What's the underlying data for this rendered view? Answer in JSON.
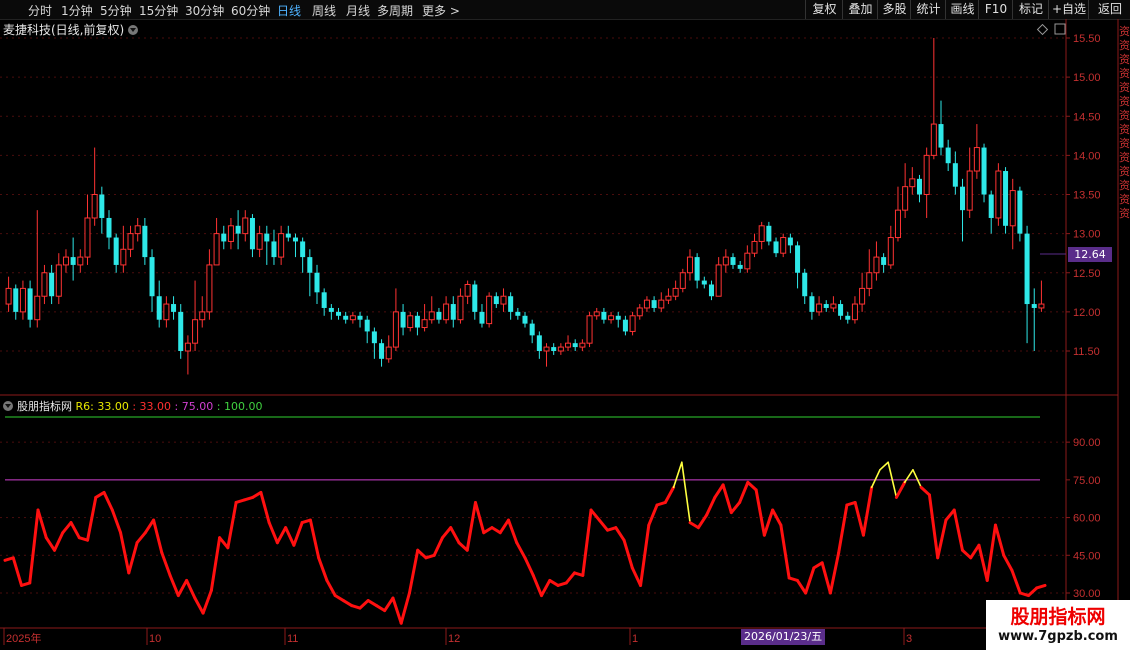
{
  "toolbar": {
    "timeframes": [
      "分时",
      "1分钟",
      "5分钟",
      "15分钟",
      "30分钟",
      "60分钟",
      "日线",
      "周线",
      "月线",
      "多周期",
      "更多 >"
    ],
    "active": "日线",
    "right_buttons": [
      "复权",
      "叠加",
      "多股",
      "统计",
      "画线",
      "F10",
      "标记",
      "+自选",
      "返回"
    ]
  },
  "chart": {
    "title": "麦捷科技(日线,前复权)",
    "price_axis": [
      "15.50",
      "15.00",
      "14.50",
      "14.00",
      "13.50",
      "13.00",
      "12.50",
      "12.00",
      "11.50"
    ],
    "current_price": "12.64",
    "indicator_label": "股朋指标网",
    "indicator_values": [
      {
        "text": "R6: 33.00",
        "color": "#e8e800"
      },
      {
        "text": " : 33.00",
        "color": "#ff3030"
      },
      {
        "text": " : 75.00",
        "color": "#d040d0"
      },
      {
        "text": " : 100.00",
        "color": "#40d040"
      }
    ],
    "indicator_axis": [
      "90.00",
      "75.00",
      "60.00",
      "45.00",
      "30.00"
    ],
    "x_labels": [
      "2025年",
      "10",
      "11",
      "12",
      "1",
      "3"
    ],
    "date_badge": "2026/01/23/五",
    "colors": {
      "up": "#ff3333",
      "down": "#2ee8e8",
      "r6": "#ff1010",
      "r6_over": "#ffff40",
      "level75": "#d040d0",
      "level100": "#30d030"
    }
  },
  "chart_data": [
    {
      "type": "candlestick",
      "ylim": [
        11.0,
        15.6
      ],
      "candles": [
        [
          12.1,
          12.3,
          12.45,
          12.0
        ],
        [
          12.3,
          12.0,
          12.35,
          11.9
        ],
        [
          12.0,
          12.3,
          12.4,
          11.9
        ],
        [
          12.3,
          11.9,
          12.4,
          11.8
        ],
        [
          11.9,
          12.2,
          13.3,
          11.8
        ],
        [
          12.2,
          12.5,
          12.6,
          12.1
        ],
        [
          12.5,
          12.2,
          12.6,
          12.1
        ],
        [
          12.2,
          12.6,
          12.75,
          12.1
        ],
        [
          12.6,
          12.7,
          12.8,
          12.5
        ],
        [
          12.7,
          12.6,
          12.95,
          12.4
        ],
        [
          12.6,
          12.7,
          12.8,
          12.5
        ],
        [
          12.7,
          13.2,
          13.5,
          12.6
        ],
        [
          13.2,
          13.5,
          14.1,
          13.1
        ],
        [
          13.5,
          13.2,
          13.6,
          13.0
        ],
        [
          13.2,
          12.95,
          13.3,
          12.8
        ],
        [
          12.95,
          12.6,
          13.0,
          12.5
        ],
        [
          12.6,
          12.8,
          13.1,
          12.5
        ],
        [
          12.8,
          13.0,
          13.1,
          12.7
        ],
        [
          13.0,
          13.1,
          13.2,
          12.9
        ],
        [
          13.1,
          12.7,
          13.2,
          12.6
        ],
        [
          12.7,
          12.2,
          12.8,
          12.0
        ],
        [
          12.2,
          11.9,
          12.4,
          11.8
        ],
        [
          11.9,
          12.1,
          12.2,
          11.8
        ],
        [
          12.1,
          12.0,
          12.2,
          11.9
        ],
        [
          12.0,
          11.5,
          12.1,
          11.4
        ],
        [
          11.5,
          11.6,
          11.7,
          11.2
        ],
        [
          11.6,
          11.9,
          12.4,
          11.5
        ],
        [
          11.9,
          12.0,
          12.2,
          11.8
        ],
        [
          12.0,
          12.6,
          12.8,
          11.9
        ],
        [
          12.6,
          13.0,
          13.2,
          12.6
        ],
        [
          13.0,
          12.9,
          13.1,
          12.8
        ],
        [
          12.9,
          13.1,
          13.2,
          12.8
        ],
        [
          13.1,
          13.0,
          13.3,
          12.8
        ],
        [
          13.0,
          13.2,
          13.3,
          12.9
        ],
        [
          13.2,
          12.8,
          13.25,
          12.7
        ],
        [
          12.8,
          13.0,
          13.1,
          12.7
        ],
        [
          13.0,
          12.9,
          13.1,
          12.6
        ],
        [
          12.9,
          12.7,
          13.05,
          12.6
        ],
        [
          12.7,
          13.0,
          13.1,
          12.6
        ],
        [
          13.0,
          12.95,
          13.1,
          12.9
        ],
        [
          12.95,
          12.9,
          13.0,
          12.7
        ],
        [
          12.9,
          12.7,
          12.95,
          12.5
        ],
        [
          12.7,
          12.5,
          12.8,
          12.2
        ],
        [
          12.5,
          12.25,
          12.6,
          12.1
        ],
        [
          12.25,
          12.05,
          12.3,
          11.95
        ],
        [
          12.05,
          12.0,
          12.1,
          11.9
        ],
        [
          12.0,
          11.95,
          12.05,
          11.9
        ],
        [
          11.95,
          11.9,
          12.0,
          11.85
        ],
        [
          11.9,
          11.95,
          12.0,
          11.85
        ],
        [
          11.95,
          11.9,
          12.0,
          11.8
        ],
        [
          11.9,
          11.75,
          11.95,
          11.6
        ],
        [
          11.75,
          11.6,
          11.8,
          11.4
        ],
        [
          11.6,
          11.4,
          11.65,
          11.3
        ],
        [
          11.4,
          11.55,
          11.7,
          11.35
        ],
        [
          11.55,
          12.0,
          12.3,
          11.5
        ],
        [
          12.0,
          11.8,
          12.1,
          11.7
        ],
        [
          11.8,
          11.95,
          12.0,
          11.75
        ],
        [
          11.95,
          11.8,
          12.0,
          11.7
        ],
        [
          11.8,
          11.9,
          12.1,
          11.75
        ],
        [
          11.9,
          12.0,
          12.2,
          11.85
        ],
        [
          12.0,
          11.9,
          12.05,
          11.85
        ],
        [
          11.9,
          12.1,
          12.2,
          11.85
        ],
        [
          12.1,
          11.9,
          12.2,
          11.8
        ],
        [
          11.9,
          12.2,
          12.3,
          11.85
        ],
        [
          12.2,
          12.35,
          12.4,
          12.1
        ],
        [
          12.35,
          12.0,
          12.4,
          11.9
        ],
        [
          12.0,
          11.85,
          12.1,
          11.8
        ],
        [
          11.85,
          12.2,
          12.25,
          11.8
        ],
        [
          12.2,
          12.1,
          12.25,
          12.05
        ],
        [
          12.1,
          12.2,
          12.3,
          12.0
        ],
        [
          12.2,
          12.0,
          12.25,
          11.9
        ],
        [
          12.0,
          11.95,
          12.05,
          11.9
        ],
        [
          11.95,
          11.85,
          12.0,
          11.8
        ],
        [
          11.85,
          11.7,
          11.9,
          11.6
        ],
        [
          11.7,
          11.5,
          11.75,
          11.4
        ],
        [
          11.5,
          11.55,
          11.6,
          11.3
        ],
        [
          11.55,
          11.5,
          11.6,
          11.45
        ],
        [
          11.5,
          11.55,
          11.6,
          11.45
        ],
        [
          11.55,
          11.6,
          11.7,
          11.5
        ],
        [
          11.6,
          11.55,
          11.65,
          11.5
        ],
        [
          11.55,
          11.6,
          11.65,
          11.5
        ],
        [
          11.6,
          11.95,
          12.0,
          11.55
        ],
        [
          11.95,
          12.0,
          12.05,
          11.9
        ],
        [
          12.0,
          11.9,
          12.05,
          11.85
        ],
        [
          11.9,
          11.95,
          12.0,
          11.85
        ],
        [
          11.95,
          11.9,
          12.0,
          11.8
        ],
        [
          11.9,
          11.75,
          11.95,
          11.7
        ],
        [
          11.75,
          11.95,
          12.0,
          11.7
        ],
        [
          11.95,
          12.05,
          12.1,
          11.9
        ],
        [
          12.05,
          12.15,
          12.2,
          12.0
        ],
        [
          12.15,
          12.05,
          12.2,
          12.0
        ],
        [
          12.05,
          12.15,
          12.25,
          12.0
        ],
        [
          12.15,
          12.2,
          12.3,
          12.1
        ],
        [
          12.2,
          12.3,
          12.4,
          12.15
        ],
        [
          12.3,
          12.5,
          12.55,
          12.25
        ],
        [
          12.5,
          12.7,
          12.8,
          12.4
        ],
        [
          12.7,
          12.4,
          12.75,
          12.3
        ],
        [
          12.4,
          12.35,
          12.45,
          12.3
        ],
        [
          12.35,
          12.2,
          12.4,
          12.15
        ],
        [
          12.2,
          12.6,
          12.7,
          12.2
        ],
        [
          12.6,
          12.7,
          12.8,
          12.5
        ],
        [
          12.7,
          12.6,
          12.75,
          12.55
        ],
        [
          12.6,
          12.55,
          12.65,
          12.5
        ],
        [
          12.55,
          12.75,
          12.85,
          12.5
        ],
        [
          12.75,
          12.9,
          13.0,
          12.7
        ],
        [
          12.9,
          13.1,
          13.15,
          12.8
        ],
        [
          13.1,
          12.9,
          13.15,
          12.85
        ],
        [
          12.9,
          12.75,
          12.95,
          12.7
        ],
        [
          12.75,
          12.95,
          13.0,
          12.7
        ],
        [
          12.95,
          12.85,
          13.0,
          12.75
        ],
        [
          12.85,
          12.5,
          12.9,
          12.3
        ],
        [
          12.5,
          12.2,
          12.55,
          12.1
        ],
        [
          12.2,
          12.0,
          12.25,
          11.9
        ],
        [
          12.0,
          12.1,
          12.2,
          11.95
        ],
        [
          12.1,
          12.05,
          12.15,
          12.0
        ],
        [
          12.05,
          12.1,
          12.2,
          12.0
        ],
        [
          12.1,
          11.95,
          12.15,
          11.9
        ],
        [
          11.95,
          11.9,
          12.0,
          11.85
        ],
        [
          11.9,
          12.1,
          12.2,
          11.85
        ],
        [
          12.1,
          12.3,
          12.5,
          12.0
        ],
        [
          12.3,
          12.5,
          12.8,
          12.2
        ],
        [
          12.5,
          12.7,
          12.9,
          12.4
        ],
        [
          12.7,
          12.6,
          12.75,
          12.5
        ],
        [
          12.6,
          12.95,
          13.1,
          12.55
        ],
        [
          12.95,
          13.3,
          13.6,
          12.9
        ],
        [
          13.3,
          13.6,
          13.9,
          13.2
        ],
        [
          13.6,
          13.7,
          13.85,
          13.5
        ],
        [
          13.7,
          13.5,
          13.75,
          13.4
        ],
        [
          13.5,
          14.0,
          14.1,
          13.2
        ],
        [
          14.0,
          14.4,
          15.5,
          13.95
        ],
        [
          14.4,
          14.1,
          14.7,
          14.0
        ],
        [
          14.1,
          13.9,
          14.2,
          13.8
        ],
        [
          13.9,
          13.6,
          14.05,
          13.5
        ],
        [
          13.6,
          13.3,
          13.7,
          12.9
        ],
        [
          13.3,
          13.8,
          14.1,
          13.2
        ],
        [
          13.8,
          14.1,
          14.4,
          13.7
        ],
        [
          14.1,
          13.5,
          14.15,
          13.4
        ],
        [
          13.5,
          13.2,
          13.55,
          13.0
        ],
        [
          13.2,
          13.8,
          13.9,
          13.1
        ],
        [
          13.8,
          13.1,
          13.85,
          13.0
        ],
        [
          13.1,
          13.55,
          13.7,
          12.8
        ],
        [
          13.55,
          13.0,
          13.6,
          12.9
        ],
        [
          13.0,
          12.1,
          13.1,
          11.6
        ],
        [
          12.1,
          12.05,
          12.3,
          11.5
        ],
        [
          12.05,
          12.1,
          12.4,
          12.0
        ]
      ]
    },
    {
      "type": "line",
      "series": [
        {
          "name": "R6",
          "values": [
            43,
            44,
            33,
            34,
            63,
            52,
            47,
            54,
            58,
            52,
            51,
            68,
            70,
            63,
            54,
            38,
            50,
            54,
            59,
            46,
            37,
            29,
            35,
            28,
            22,
            31,
            52,
            48,
            66,
            67,
            68,
            70,
            58,
            50,
            56,
            49,
            58,
            59,
            44,
            35,
            29,
            27,
            25,
            24,
            27,
            25,
            23,
            28,
            18,
            30,
            47,
            44,
            45,
            52,
            56,
            50,
            47,
            66,
            54,
            56,
            54,
            59,
            50,
            44,
            37,
            29,
            35,
            33,
            34,
            38,
            37,
            63,
            59,
            55,
            56,
            51,
            40,
            33,
            57,
            65,
            66,
            72,
            82,
            58,
            56,
            61,
            68,
            73,
            62,
            66,
            74,
            71,
            53,
            63,
            57,
            36,
            35,
            30,
            40,
            42,
            30,
            46,
            65,
            66,
            53,
            72,
            79,
            82,
            68,
            74,
            79,
            72,
            69,
            44,
            59,
            63,
            47,
            44,
            49,
            35,
            57,
            45,
            39,
            30,
            29,
            32,
            33
          ]
        }
      ],
      "levels": [
        33,
        75,
        100
      ],
      "ylim": [
        25,
        100
      ]
    }
  ]
}
